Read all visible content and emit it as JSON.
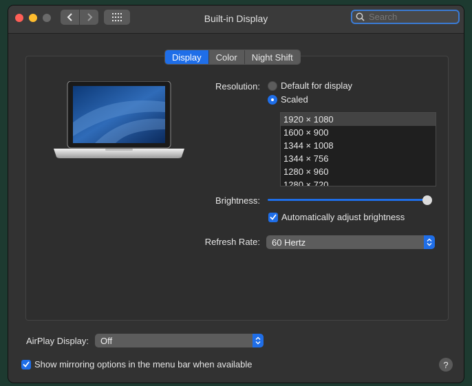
{
  "window": {
    "title": "Built-in Display"
  },
  "search": {
    "placeholder": "Search"
  },
  "tabs": [
    {
      "label": "Display"
    },
    {
      "label": "Color"
    },
    {
      "label": "Night Shift"
    }
  ],
  "resolution": {
    "label": "Resolution:",
    "options": [
      {
        "label": "Default for display",
        "selected": false
      },
      {
        "label": "Scaled",
        "selected": true
      }
    ],
    "list": [
      {
        "label": "1920 × 1080",
        "selected": true
      },
      {
        "label": "1600 × 900"
      },
      {
        "label": "1344 × 1008"
      },
      {
        "label": "1344 × 756"
      },
      {
        "label": "1280 × 960"
      },
      {
        "label": "1280 × 720"
      }
    ]
  },
  "brightness": {
    "label": "Brightness:",
    "level": 1.0,
    "auto_label": "Automatically adjust brightness",
    "auto_checked": true
  },
  "refresh": {
    "label": "Refresh Rate:",
    "value": "60 Hertz"
  },
  "airplay": {
    "label": "AirPlay Display:",
    "value": "Off"
  },
  "mirroring": {
    "label": "Show mirroring options in the menu bar when available",
    "checked": true
  },
  "help": {
    "label": "?"
  },
  "colors": {
    "accent": "#1f6ee8",
    "window_bg": "#323232"
  }
}
